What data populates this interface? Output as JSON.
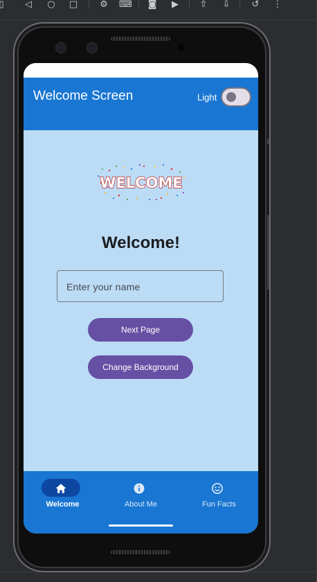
{
  "app_bar": {
    "title": "Welcome Screen",
    "theme_toggle": {
      "label": "Light",
      "checked": false
    }
  },
  "main": {
    "logo_text": "WELCOME",
    "heading": "Welcome!",
    "name_input": {
      "value": "",
      "placeholder": "Enter your name"
    },
    "next_button": "Next Page",
    "background_button": "Change Background"
  },
  "bottom_nav": {
    "items": [
      {
        "label": "Welcome",
        "icon": "home-icon",
        "selected": true
      },
      {
        "label": "About Me",
        "icon": "info-icon",
        "selected": false
      },
      {
        "label": "Fun Facts",
        "icon": "smiley-icon",
        "selected": false
      }
    ]
  },
  "colors": {
    "app_bar": "#1976d2",
    "background": "#bcdcf6",
    "button": "#6650a4",
    "selected_pill": "#0d47a1"
  },
  "emulator_toolbar": {
    "icons": [
      "rotate-icon",
      "back-icon",
      "home-icon",
      "overview-icon",
      "settings-icon",
      "keyboard-icon",
      "camera-icon",
      "record-icon",
      "upload-icon",
      "download-icon",
      "undo-icon",
      "more-icon"
    ]
  }
}
